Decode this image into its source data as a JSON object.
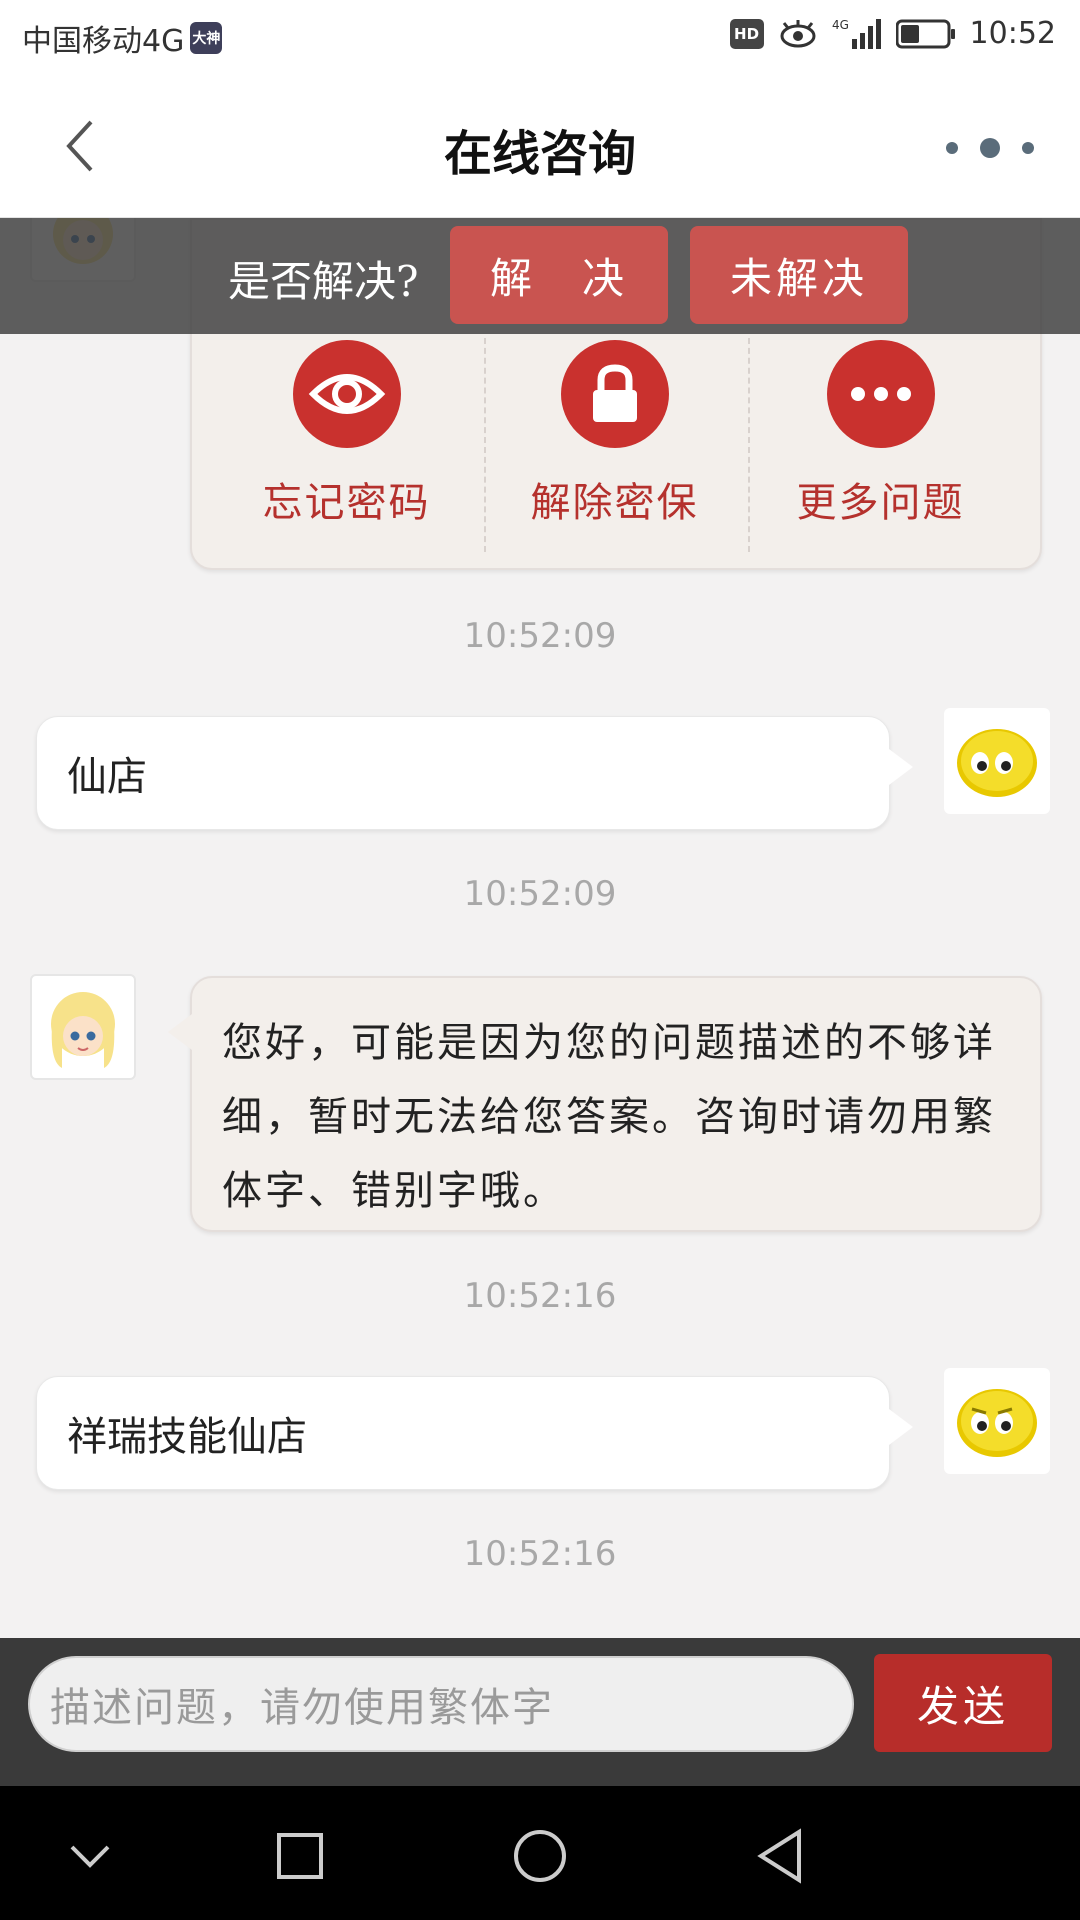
{
  "status_bar": {
    "carrier": "中国移动4G",
    "carrier_badge": "大神",
    "hd": "HD",
    "network": "4G",
    "time": "10:52",
    "battery_level": 0.4
  },
  "header": {
    "title": "在线咨询"
  },
  "resolve_bar": {
    "question": "是否解决?",
    "resolved_label": "解　决",
    "unresolved_label": "未解决"
  },
  "quick_options": [
    {
      "label": "忘记密码",
      "icon": "eye-icon"
    },
    {
      "label": "解除密保",
      "icon": "lock-icon"
    },
    {
      "label": "更多问题",
      "icon": "more-icon"
    }
  ],
  "messages": [
    {
      "type": "timestamp",
      "text": "10:52:09"
    },
    {
      "type": "user",
      "text": "仙店"
    },
    {
      "type": "timestamp",
      "text": "10:52:09"
    },
    {
      "type": "bot",
      "text": "您好，可能是因为您的问题描述的不够详细，暂时无法给您答案。咨询时请勿用繁体字、错别字哦。"
    },
    {
      "type": "timestamp",
      "text": "10:52:16"
    },
    {
      "type": "user",
      "text": "祥瑞技能仙店"
    },
    {
      "type": "timestamp",
      "text": "10:52:16"
    }
  ],
  "input": {
    "placeholder": "描述问题，请勿使用繁体字",
    "send_label": "发送"
  },
  "colors": {
    "accent": "#b72d2a",
    "bot_bubble": "#f3efeb",
    "chat_bg": "#f3f2f2"
  }
}
